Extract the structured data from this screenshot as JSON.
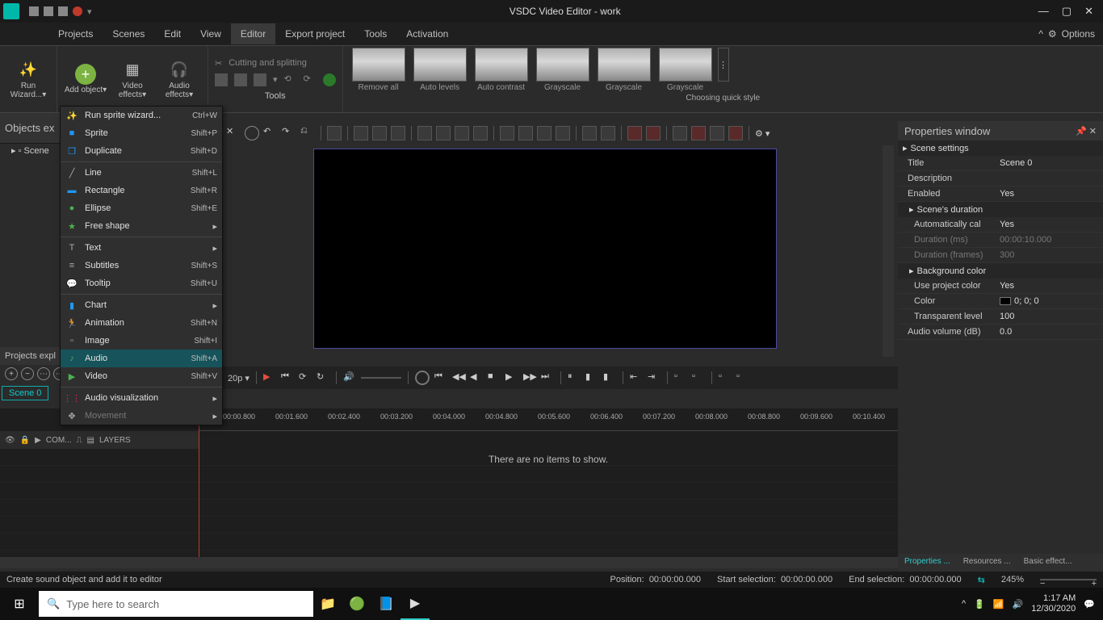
{
  "titlebar": {
    "title": "VSDC Video Editor - work"
  },
  "menubar": {
    "items": [
      "Projects",
      "Scenes",
      "Edit",
      "View",
      "Editor",
      "Export project",
      "Tools",
      "Activation"
    ],
    "active": 4,
    "options": "Options"
  },
  "ribbon": {
    "big": [
      {
        "label": "Run Wizard...▾"
      },
      {
        "label": "Add object▾"
      },
      {
        "label": "Video effects▾"
      },
      {
        "label": "Audio effects▾"
      }
    ],
    "cutsplit": "Cutting and splitting",
    "toolslabel": "Tools",
    "quick": [
      {
        "label": "Remove all"
      },
      {
        "label": "Auto levels"
      },
      {
        "label": "Auto contrast"
      },
      {
        "label": "Grayscale"
      },
      {
        "label": "Grayscale"
      },
      {
        "label": "Grayscale"
      }
    ],
    "quicklabel": "Choosing quick style"
  },
  "leftpanel": {
    "title": "Objects ex",
    "scene": "Scene"
  },
  "ctx": {
    "items": [
      {
        "icon": "✨",
        "label": "Run sprite wizard...",
        "sc": "Ctrl+W"
      },
      {
        "icon": "■",
        "iconColor": "#2196f3",
        "label": "Sprite",
        "sc": "Shift+P"
      },
      {
        "icon": "❐",
        "iconColor": "#2196f3",
        "label": "Duplicate",
        "sc": "Shift+D"
      },
      {
        "sep": true
      },
      {
        "icon": "╱",
        "label": "Line",
        "sc": "Shift+L"
      },
      {
        "icon": "▬",
        "iconColor": "#2196f3",
        "label": "Rectangle",
        "sc": "Shift+R"
      },
      {
        "icon": "●",
        "iconColor": "#4caf50",
        "label": "Ellipse",
        "sc": "Shift+E"
      },
      {
        "icon": "★",
        "iconColor": "#4caf50",
        "label": "Free shape",
        "sub": true
      },
      {
        "sep": true
      },
      {
        "icon": "T",
        "label": "Text",
        "sub": true
      },
      {
        "icon": "≡",
        "label": "Subtitles",
        "sc": "Shift+S"
      },
      {
        "icon": "💬",
        "label": "Tooltip",
        "sc": "Shift+U"
      },
      {
        "sep": true
      },
      {
        "icon": "▮",
        "iconColor": "#2196f3",
        "label": "Chart",
        "sub": true
      },
      {
        "icon": "🏃",
        "iconColor": "#ff9800",
        "label": "Animation",
        "sc": "Shift+N"
      },
      {
        "icon": "▫",
        "label": "Image",
        "sc": "Shift+I"
      },
      {
        "icon": "♪",
        "iconColor": "#4caf50",
        "label": "Audio",
        "sc": "Shift+A",
        "hover": true
      },
      {
        "icon": "▶",
        "iconColor": "#4caf50",
        "label": "Video",
        "sc": "Shift+V"
      },
      {
        "sep": true
      },
      {
        "icon": "⋮⋮",
        "iconColor": "#e91e63",
        "label": "Audio visualization",
        "sub": true
      },
      {
        "icon": "✥",
        "label": "Movement",
        "sub": true,
        "disabled": true
      }
    ]
  },
  "projexpl": {
    "title": "Projects expl",
    "scene": "Scene 0"
  },
  "playbar": {
    "res": "20p ▾"
  },
  "ruler": [
    "00:00.800",
    "00:01.600",
    "00:02.400",
    "00:03.200",
    "00:04.000",
    "00:04.800",
    "00:05.600",
    "00:06.400",
    "00:07.200",
    "00:08.000",
    "00:08.800",
    "00:09.600",
    "00:10.400"
  ],
  "layersh": {
    "com": "COM...",
    "layers": "LAYERS"
  },
  "timeline": {
    "empty": "There are no items to show."
  },
  "props": {
    "title": "Properties window",
    "cats": {
      "scene": "Scene settings",
      "duration": "Scene's duration",
      "bg": "Background color"
    },
    "rows": {
      "title_k": "Title",
      "title_v": "Scene 0",
      "desc_k": "Description",
      "desc_v": "",
      "enabled_k": "Enabled",
      "enabled_v": "Yes",
      "auto_k": "Automatically cal",
      "auto_v": "Yes",
      "durms_k": "Duration (ms)",
      "durms_v": "00:00:10.000",
      "durfr_k": "Duration (frames)",
      "durfr_v": "300",
      "useproj_k": "Use project color",
      "useproj_v": "Yes",
      "color_k": "Color",
      "color_v": "0; 0; 0",
      "transp_k": "Transparent level",
      "transp_v": "100",
      "audio_k": "Audio volume (dB)",
      "audio_v": "0.0"
    },
    "tabs": [
      "Properties ...",
      "Resources ...",
      "Basic effect..."
    ]
  },
  "status": {
    "msg": "Create sound object and add it to editor",
    "pos_l": "Position:",
    "pos_v": "00:00:00.000",
    "ss_l": "Start selection:",
    "ss_v": "00:00:00.000",
    "es_l": "End selection:",
    "es_v": "00:00:00.000",
    "zoom": "245%"
  },
  "taskbar": {
    "search": "Type here to search",
    "time": "1:17 AM",
    "date": "12/30/2020"
  }
}
